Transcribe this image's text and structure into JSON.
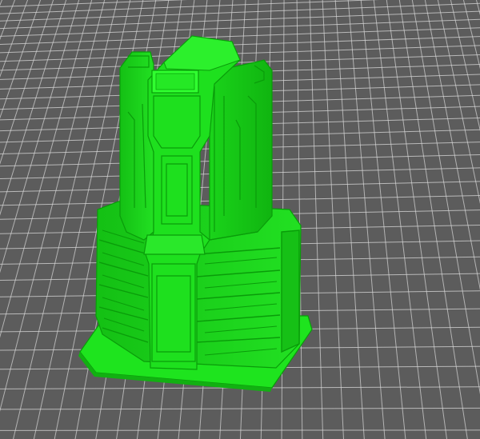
{
  "viewport": {
    "background": "#5c5c5c",
    "grid_line_color": "#d8d8d8",
    "model_color": "#1fdb1f"
  },
  "model": {
    "name_icon": "sci-fi-tower-model"
  }
}
